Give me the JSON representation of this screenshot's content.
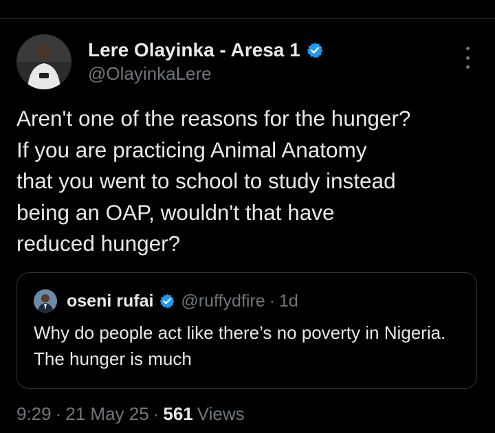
{
  "author": {
    "name": "Lere Olayinka - Aresa 1",
    "handle": "@OlayinkaLere",
    "verified": true
  },
  "tweet": {
    "text": "Aren't one of the reasons for the hunger?\nIf you are practicing Animal Anatomy\nthat you went to school to study instead\nbeing an OAP,  wouldn't that have\nreduced hunger?"
  },
  "quote": {
    "name": "oseni rufai",
    "handle": "@ruffydfire",
    "separator": "·",
    "time": "1d",
    "verified": true,
    "text": "Why do people act like there’s no poverty in Nigeria. The hunger is much"
  },
  "meta": {
    "time": "9:29",
    "separator1": "·",
    "date": "21 May 25",
    "separator2": "·",
    "views_count": "561",
    "views_label": "Views"
  },
  "icons": {
    "verified": "verified-badge-icon",
    "more": "more-options-icon"
  },
  "colors": {
    "background": "#000000",
    "text": "#e7e9ea",
    "secondary_text": "#71767b",
    "verified": "#1d9bf0",
    "border": "#2f3336"
  }
}
